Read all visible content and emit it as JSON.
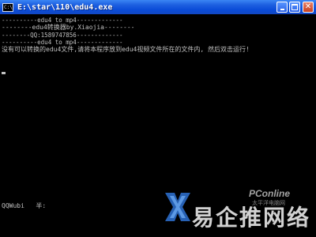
{
  "window": {
    "title": "E:\\star\\110\\edu4.exe",
    "icon_label": "C:\\",
    "controls": {
      "minimize": "minimize-icon",
      "maximize": "maximize-icon",
      "close": "close-icon"
    },
    "close_glyph": "✕"
  },
  "console": {
    "lines": [
      "----------edu4 to mp4-------------",
      "--------edu4转换器by.Xiaojia--------",
      "--------QQ:1589747856-------------",
      "----------edu4 to mp4-------------",
      "没有可以转换的edu4文件,请将本程序放到edu4视频文件所在的文件内, 然后双击运行!"
    ],
    "ime_status": "QQWubi   半:"
  },
  "watermark": {
    "text": "易企推网络",
    "brand": "PConline",
    "sub": "太平洋电脑网"
  },
  "colors": {
    "titlebar": "#0a4bd8",
    "console_bg": "#000000",
    "console_text": "#c0c0c0"
  }
}
